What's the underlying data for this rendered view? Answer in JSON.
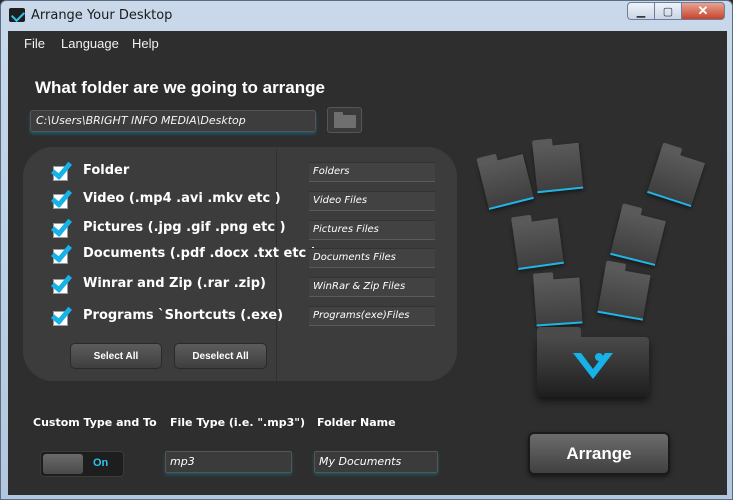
{
  "window": {
    "title": "Arrange Your Desktop"
  },
  "menu": [
    "File",
    "Language",
    "Help"
  ],
  "main": {
    "heading": "What folder are we going to arrange",
    "path": "C:\\Users\\BRIGHT INFO MEDIA\\Desktop"
  },
  "options": [
    {
      "label": "Folder",
      "checked": true,
      "target": "Folders"
    },
    {
      "label": "Video (.mp4 .avi .mkv etc )",
      "checked": true,
      "target": "Video Files"
    },
    {
      "label": "Pictures (.jpg .gif .png etc )",
      "checked": true,
      "target": "Pictures Files"
    },
    {
      "label": "Documents (.pdf .docx .txt etc )",
      "checked": true,
      "target": "Documents Files"
    },
    {
      "label": "Winrar and Zip (.rar .zip)",
      "checked": true,
      "target": "WinRar & Zip Files"
    },
    {
      "label": "Programs `Shortcuts (.exe)",
      "checked": true,
      "target": "Programs(exe)Files"
    }
  ],
  "buttons": {
    "select_all": "Select All",
    "deselect_all": "Deselect All",
    "arrange": "Arrange"
  },
  "custom": {
    "label": "Custom Type and To",
    "toggle_state": "On",
    "file_type_label": "File Type (i.e. \".mp3\")",
    "file_type_value": "mp3",
    "folder_name_label": "Folder Name",
    "folder_name_value": "My Documents"
  },
  "colors": {
    "accent": "#16b2e8",
    "background": "#2e2e2e",
    "panel": "#3c3c3c"
  }
}
